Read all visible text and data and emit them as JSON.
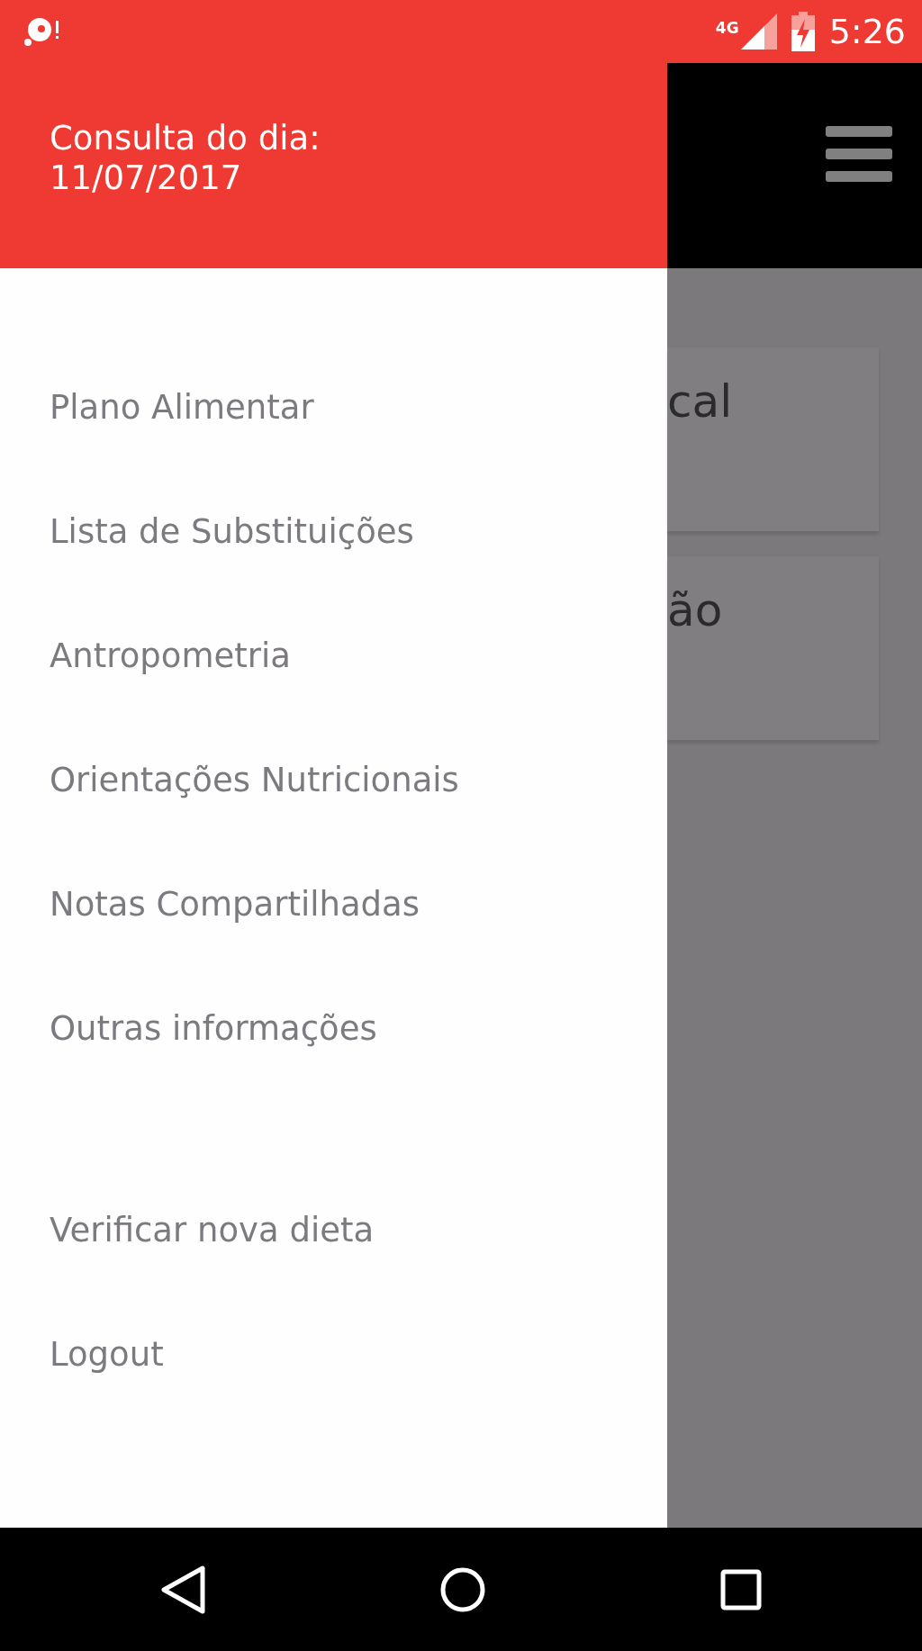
{
  "status_bar": {
    "network": "4G",
    "time": "5:26"
  },
  "drawer": {
    "header": {
      "line_1": "Consulta do dia:",
      "line_2": "11/07/2017"
    },
    "sections": [
      {
        "items": [
          "Plano Alimentar",
          "Lista de Substituições",
          "Antropometria",
          "Orientações Nutricionais",
          "Notas Compartilhadas",
          "Outras informações"
        ]
      },
      {
        "items": [
          "Verificar nova dieta",
          "Logout"
        ]
      }
    ]
  },
  "background": {
    "cards": [
      "cal",
      "ão"
    ]
  }
}
